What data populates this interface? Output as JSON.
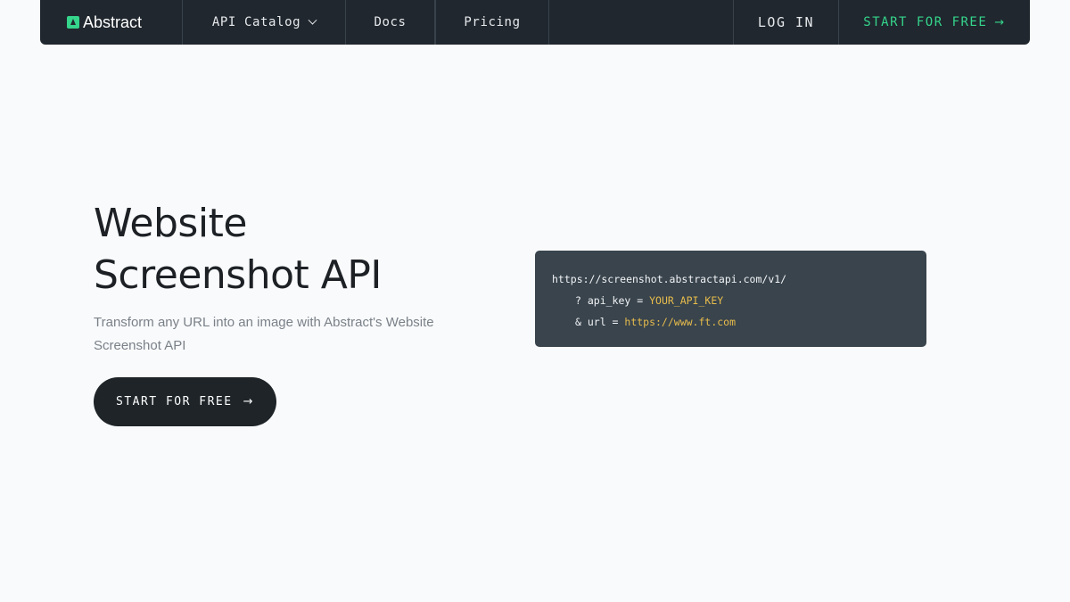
{
  "nav": {
    "logo_text": "Abstract",
    "api_catalog": "API Catalog",
    "docs": "Docs",
    "pricing": "Pricing",
    "login": "LOG IN",
    "start_free": "START FOR FREE",
    "accent_color": "#35d58c"
  },
  "hero": {
    "title_line1": "Website",
    "title_line2": "Screenshot API",
    "subtitle": "Transform any URL into an image with Abstract's Website Screenshot API",
    "cta_label": "START FOR FREE"
  },
  "code": {
    "endpoint": "https://screenshot.abstractapi.com/v1/",
    "param1_prefix": "? api_key = ",
    "param1_value": "YOUR_API_KEY",
    "param2_prefix": "& url = ",
    "param2_value": "https://www.ft.com"
  },
  "icons": {
    "chevron": "chevron-down-icon",
    "arrow": "arrow-right-icon",
    "logo": "abstract-logo-icon"
  }
}
